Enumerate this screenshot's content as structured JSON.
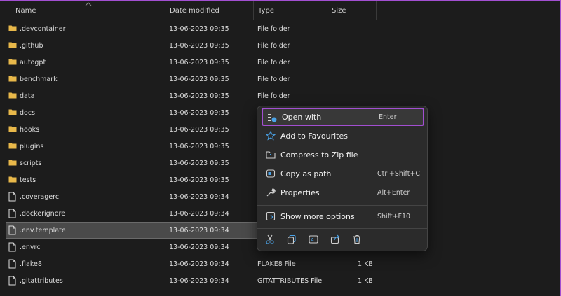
{
  "columns": {
    "name": "Name",
    "date": "Date modified",
    "type": "Type",
    "size": "Size"
  },
  "files": [
    {
      "name": ".devcontainer",
      "date": "13-06-2023 09:35",
      "type": "File folder",
      "size": "",
      "kind": "folder"
    },
    {
      "name": ".github",
      "date": "13-06-2023 09:35",
      "type": "File folder",
      "size": "",
      "kind": "folder"
    },
    {
      "name": "autogpt",
      "date": "13-06-2023 09:35",
      "type": "File folder",
      "size": "",
      "kind": "folder"
    },
    {
      "name": "benchmark",
      "date": "13-06-2023 09:35",
      "type": "File folder",
      "size": "",
      "kind": "folder"
    },
    {
      "name": "data",
      "date": "13-06-2023 09:35",
      "type": "File folder",
      "size": "",
      "kind": "folder"
    },
    {
      "name": "docs",
      "date": "13-06-2023 09:35",
      "type": "",
      "size": "",
      "kind": "folder"
    },
    {
      "name": "hooks",
      "date": "13-06-2023 09:35",
      "type": "",
      "size": "",
      "kind": "folder"
    },
    {
      "name": "plugins",
      "date": "13-06-2023 09:35",
      "type": "",
      "size": "",
      "kind": "folder"
    },
    {
      "name": "scripts",
      "date": "13-06-2023 09:35",
      "type": "",
      "size": "",
      "kind": "folder"
    },
    {
      "name": "tests",
      "date": "13-06-2023 09:35",
      "type": "",
      "size": "",
      "kind": "folder"
    },
    {
      "name": ".coveragerc",
      "date": "13-06-2023 09:34",
      "type": "",
      "size": "",
      "kind": "file"
    },
    {
      "name": ".dockerignore",
      "date": "13-06-2023 09:34",
      "type": "",
      "size": "",
      "kind": "file"
    },
    {
      "name": ".env.template",
      "date": "13-06-2023 09:34",
      "type": "",
      "size": "",
      "kind": "file",
      "selected": true
    },
    {
      "name": ".envrc",
      "date": "13-06-2023 09:34",
      "type": "",
      "size": "",
      "kind": "file"
    },
    {
      "name": ".flake8",
      "date": "13-06-2023 09:34",
      "type": "FLAKE8 File",
      "size": "1 KB",
      "kind": "file"
    },
    {
      "name": ".gitattributes",
      "date": "13-06-2023 09:34",
      "type": "GITATTRIBUTES File",
      "size": "1 KB",
      "kind": "file"
    }
  ],
  "context_menu": {
    "items": [
      {
        "label": "Open with",
        "shortcut": "Enter",
        "icon": "open-with-icon"
      },
      {
        "label": "Add to Favourites",
        "shortcut": "",
        "icon": "star-icon"
      },
      {
        "label": "Compress to Zip file",
        "shortcut": "",
        "icon": "zip-folder-icon"
      },
      {
        "label": "Copy as path",
        "shortcut": "Ctrl+Shift+C",
        "icon": "copy-path-icon"
      },
      {
        "label": "Properties",
        "shortcut": "Alt+Enter",
        "icon": "wrench-icon"
      }
    ],
    "more": {
      "label": "Show more options",
      "shortcut": "Shift+F10",
      "icon": "more-options-icon"
    },
    "quick_actions": [
      "cut-icon",
      "copy-icon",
      "rename-icon",
      "share-icon",
      "delete-icon"
    ]
  },
  "colors": {
    "highlight_border": "#a24fd1",
    "folder": "#e8b84a",
    "accent_icon": "#4aa3e8"
  }
}
